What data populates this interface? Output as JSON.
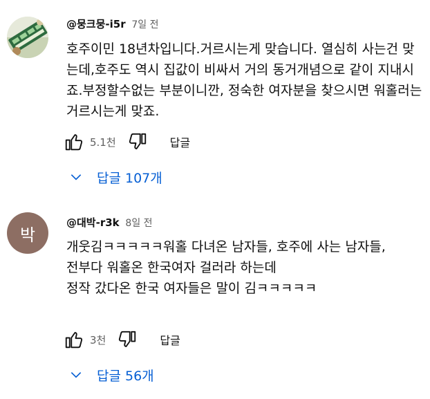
{
  "comments": [
    {
      "author": "@뭉크뭉-i5r",
      "time": "7일 전",
      "text": "호주이민 18년차입니다.거르시는게 맞습니다. 열심히 사는건 맞는데,호주도 역시 집값이 비싸서 거의 동거개념으로 같이 지내시죠.부정할수없는 부분이니깐, 정숙한 여자분을 찾으시면 워홀러는 거르시는게 맞죠.",
      "likes": "5.1천",
      "reply_label": "답글",
      "replies_label": "답글 107개",
      "avatar_icon": "profile-photo-icon"
    },
    {
      "author": "@대박-r3k",
      "time": "8일 전",
      "avatar_letter": "박",
      "avatar_color": "#8d6e63",
      "text": "개웃김ㅋㅋㅋㅋㅋ워홀 다녀온 남자들, 호주에 사는 남자들,\n전부다 워홀온 한국여자 걸러라 하는데\n정작 갔다온 한국 여자들은 말이 김ㅋㅋㅋㅋㅋ",
      "likes": "3천",
      "reply_label": "답글",
      "replies_label": "답글 56개"
    }
  ],
  "colors": {
    "link": "#065fd4",
    "meta": "#606060",
    "text": "#0f0f0f"
  }
}
